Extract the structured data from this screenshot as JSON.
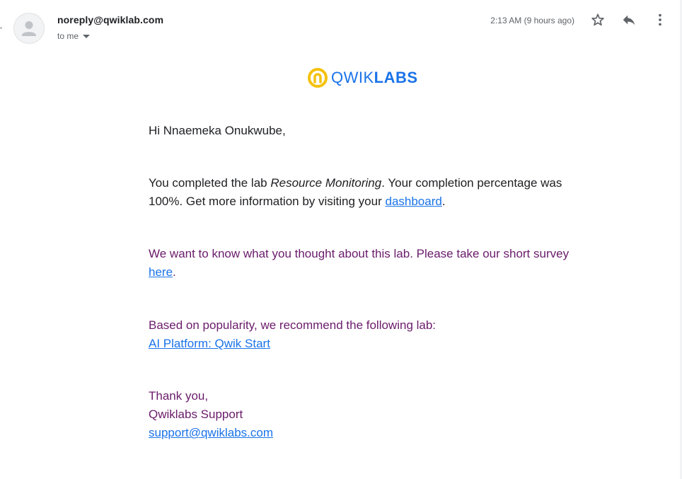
{
  "email": {
    "sender": "noreply@qwiklab.com",
    "recipient_label": "to me",
    "timestamp": "2:13 AM (9 hours ago)",
    "icons": [
      "avatar-icon",
      "star-icon",
      "reply-icon",
      "more-vertical-icon",
      "chevron-down-icon"
    ]
  },
  "logo": {
    "word_light": "QWIK",
    "word_bold": "LABS",
    "colors": {
      "ring": "#f4c20d",
      "text": "#1a73e8"
    }
  },
  "body": {
    "greeting": "Hi Nnaemeka Onukwube,",
    "completion_prefix": "You completed the lab ",
    "lab_name": "Resource Monitoring",
    "completion_mid": ". Your completion percentage was 100%. Get more information by visiting your ",
    "dashboard_link": "dashboard",
    "completion_suffix": ".",
    "survey_prefix": "We want to know what you thought about this lab. Please take our short survey ",
    "survey_link": "here",
    "survey_suffix": ".",
    "recommend_text": "Based on popularity, we recommend the following lab:",
    "recommend_link": "AI Platform: Qwik Start",
    "thanks": "Thank you,",
    "signature": "Qwiklabs Support",
    "support_email": "support@qwiklabs.com"
  },
  "colors": {
    "link": "#1a73e8",
    "purple_text": "#6a1b6a",
    "muted": "#5f6368"
  }
}
